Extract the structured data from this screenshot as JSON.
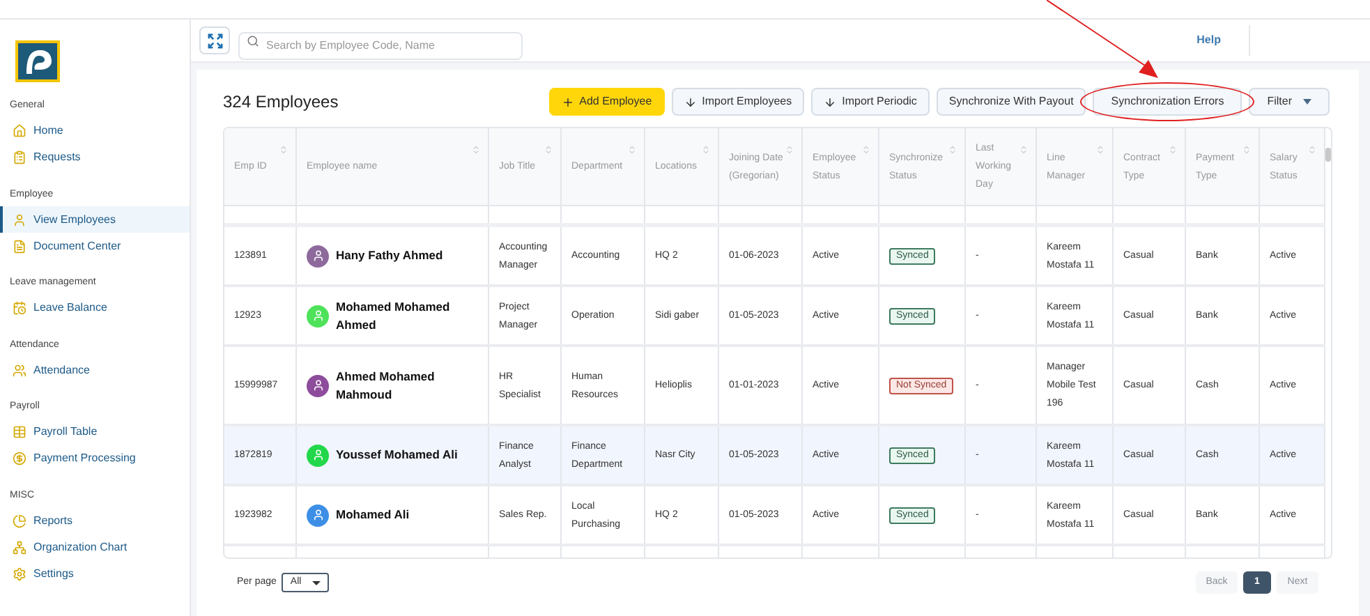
{
  "sidebar": {
    "sections": [
      {
        "title": "General",
        "items": [
          {
            "label": "Home",
            "selected": false
          },
          {
            "label": "Requests",
            "selected": false
          }
        ]
      },
      {
        "title": "Employee",
        "items": [
          {
            "label": "View Employees",
            "selected": true
          },
          {
            "label": "Document Center",
            "selected": false
          }
        ]
      },
      {
        "title": "Leave management",
        "items": [
          {
            "label": "Leave Balance",
            "selected": false
          }
        ]
      },
      {
        "title": "Attendance",
        "items": [
          {
            "label": "Attendance",
            "selected": false
          }
        ]
      },
      {
        "title": "Payroll",
        "items": [
          {
            "label": "Payroll Table",
            "selected": false
          },
          {
            "label": "Payment Processing",
            "selected": false
          }
        ]
      },
      {
        "title": "MISC",
        "items": [
          {
            "label": "Reports",
            "selected": false
          },
          {
            "label": "Organization Chart",
            "selected": false
          },
          {
            "label": "Settings",
            "selected": false
          }
        ]
      }
    ]
  },
  "header": {
    "search": {
      "placeholder": "Search by Employee Code, Name"
    },
    "help": "Help"
  },
  "page": {
    "title": "324 Employees",
    "actions": [
      {
        "label": "Add Employee",
        "kind": "primary"
      },
      {
        "label": "Import Employees",
        "kind": "import"
      },
      {
        "label": "Import Periodic",
        "kind": "import"
      },
      {
        "label": "Synchronize With Payout",
        "kind": "plain"
      },
      {
        "label": "Synchronization Errors",
        "kind": "highlighted"
      },
      {
        "label": "Filter",
        "kind": "dropdown"
      }
    ]
  },
  "table": {
    "columns": [
      "Emp ID",
      "Employee name",
      "Job Title",
      "Department",
      "Locations",
      "Joining Date (Gregorian)",
      "Employee Status",
      "Synchronize Status",
      "Last Working Day",
      "Line Manager",
      "Contract Type",
      "Payment Type",
      "Salary Status"
    ],
    "rows": [
      {
        "selected": false,
        "cells": [
          "123891",
          "Hany Fathy Ahmed",
          "Accounting Manager",
          "Accounting",
          "HQ 2",
          "01-06-2023",
          "Active",
          "Synced",
          "-",
          "Kareem Mostafa 11",
          "Casual",
          "Bank",
          "Active"
        ],
        "color": "#8e6a9c",
        "synced": true
      },
      {
        "selected": false,
        "cells": [
          "12923",
          "Mohamed Mohamed Ahmed",
          "Project Manager",
          "Operation",
          "Sidi gaber",
          "01-05-2023",
          "Active",
          "Synced",
          "-",
          "Kareem Mostafa 11",
          "Casual",
          "Bank",
          "Active"
        ],
        "color": "#4ee25a",
        "synced": true
      },
      {
        "selected": false,
        "cells": [
          "15999987",
          "Ahmed Mohamed Mahmoud",
          "HR Specialist",
          "Human Resources",
          "Helioplis",
          "01-01-2023",
          "Active",
          "Not Synced",
          "-",
          "Manager Mobile Test 196",
          "Casual",
          "Cash",
          "Active"
        ],
        "color": "#8e4c9c",
        "synced": false
      },
      {
        "selected": true,
        "cells": [
          "1872819",
          "Youssef Mohamed Ali",
          "Finance Analyst",
          "Finance Department",
          "Nasr City",
          "01-05-2023",
          "Active",
          "Synced",
          "-",
          "Kareem Mostafa 11",
          "Casual",
          "Cash",
          "Active"
        ],
        "color": "#22d84a",
        "synced": true
      },
      {
        "selected": false,
        "cells": [
          "1923982",
          "Mohamed Ali",
          "Sales Rep.",
          "Local Purchasing",
          "HQ 2",
          "01-05-2023",
          "Active",
          "Synced",
          "-",
          "Kareem Mostafa 11",
          "Casual",
          "Bank",
          "Active"
        ],
        "color": "#3d8fe6",
        "synced": true
      }
    ]
  },
  "footer": {
    "per_page_label": "Per page",
    "per_page_value": "All",
    "pages": [
      {
        "label": "Back",
        "kind": "nav",
        "disabled": true
      },
      {
        "label": "1",
        "kind": "page",
        "selected": true
      },
      {
        "label": "Next",
        "kind": "nav",
        "disabled": true
      }
    ]
  }
}
